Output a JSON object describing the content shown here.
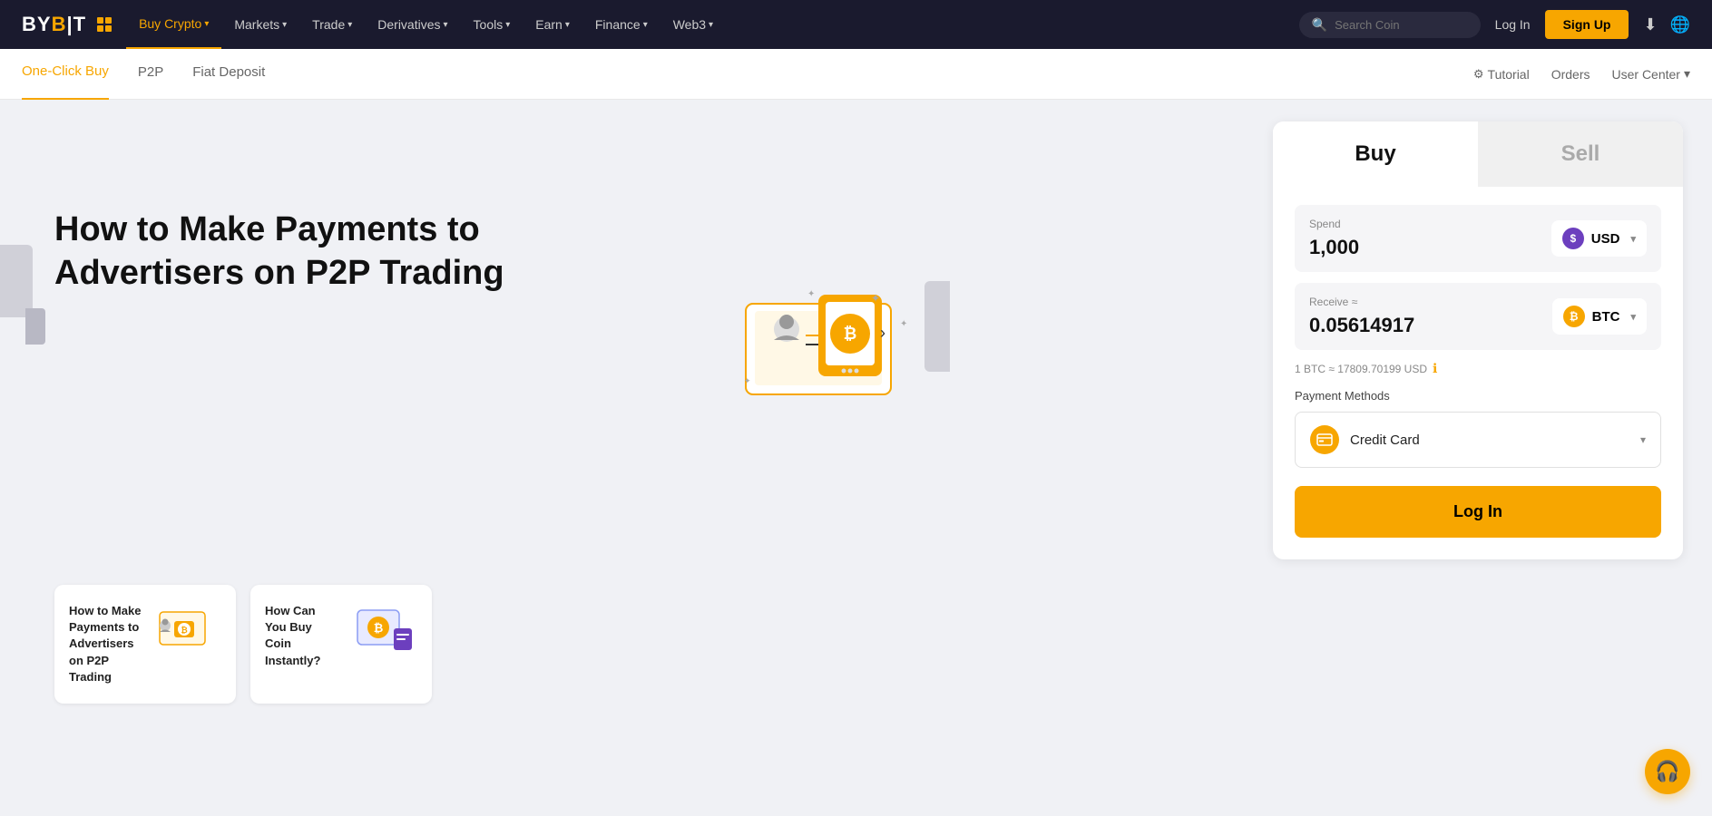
{
  "navbar": {
    "logo_text": "BYB",
    "logo_highlight": "T",
    "menu": [
      {
        "label": "Buy Crypto",
        "has_arrow": true,
        "active": true
      },
      {
        "label": "Markets",
        "has_arrow": true,
        "active": false
      },
      {
        "label": "Trade",
        "has_arrow": true,
        "active": false
      },
      {
        "label": "Derivatives",
        "has_arrow": true,
        "active": false
      },
      {
        "label": "Tools",
        "has_arrow": true,
        "active": false
      },
      {
        "label": "Earn",
        "has_arrow": true,
        "active": false
      },
      {
        "label": "Finance",
        "has_arrow": true,
        "active": false
      },
      {
        "label": "Web3",
        "has_arrow": true,
        "active": false
      }
    ],
    "search_placeholder": "Search Coin",
    "login_label": "Log In",
    "signup_label": "Sign Up"
  },
  "subnav": {
    "items": [
      {
        "label": "One-Click Buy",
        "active": true
      },
      {
        "label": "P2P",
        "active": false
      },
      {
        "label": "Fiat Deposit",
        "active": false
      }
    ],
    "right": [
      {
        "label": "Tutorial",
        "has_icon": true
      },
      {
        "label": "Orders"
      },
      {
        "label": "User Center",
        "has_arrow": true
      }
    ]
  },
  "hero": {
    "title": "How to Make Payments to Advertisers on P2P Trading"
  },
  "cards": [
    {
      "title": "How to Make Payments to Advertisers on P2P Trading"
    },
    {
      "title": "How Can You Buy Coin Instantly?"
    }
  ],
  "buy_sell": {
    "buy_label": "Buy",
    "sell_label": "Sell",
    "spend_label": "Spend",
    "spend_value": "1,000",
    "receive_label": "Receive ≈",
    "receive_value": "0.05614917",
    "currency_from": "USD",
    "currency_to": "BTC",
    "rate_text": "1 BTC ≈ 17809.70199 USD",
    "payment_label": "Payment Methods",
    "payment_method": "Credit Card",
    "login_btn": "Log In"
  }
}
